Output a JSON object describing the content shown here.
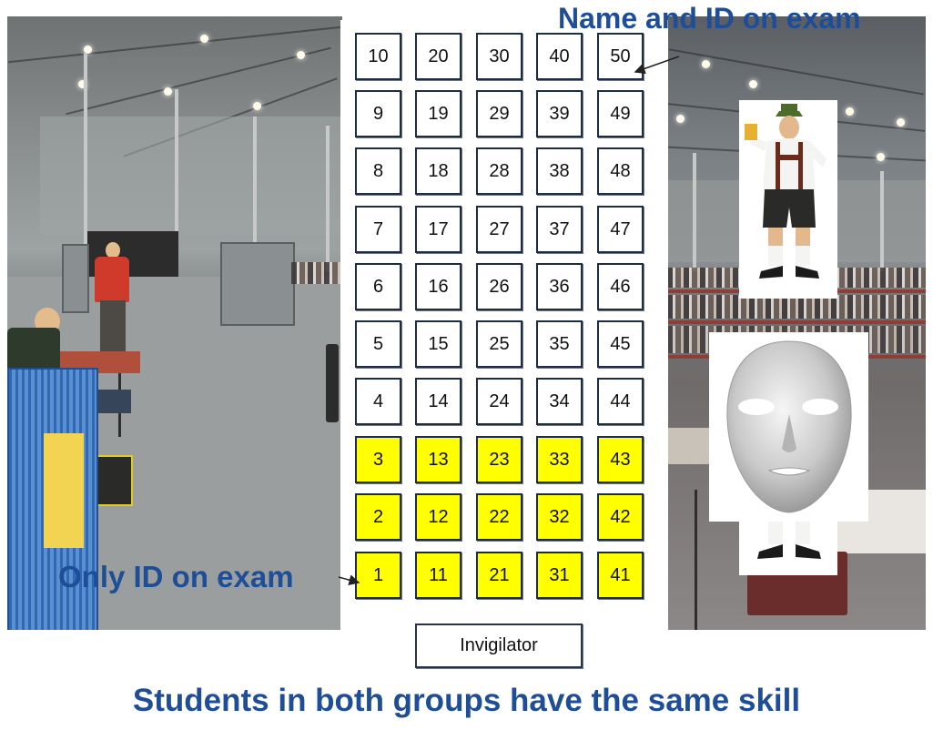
{
  "labels": {
    "name_and_id": "Name and ID on exam",
    "only_id": "Only ID on exam",
    "caption": "Students in both groups have the same skill"
  },
  "seating_chart": {
    "columns": [
      [
        "10",
        "9",
        "8",
        "7",
        "6",
        "5",
        "4",
        "3",
        "2",
        "1"
      ],
      [
        "20",
        "19",
        "18",
        "17",
        "16",
        "15",
        "14",
        "13",
        "12",
        "11"
      ],
      [
        "30",
        "29",
        "28",
        "27",
        "26",
        "25",
        "24",
        "23",
        "22",
        "21"
      ],
      [
        "40",
        "39",
        "38",
        "37",
        "36",
        "35",
        "34",
        "33",
        "32",
        "31"
      ],
      [
        "50",
        "49",
        "48",
        "47",
        "46",
        "45",
        "44",
        "43",
        "42",
        "41"
      ]
    ],
    "highlighted_rows_from_bottom": 3,
    "invigilator": "Invigilator"
  },
  "colors": {
    "label_blue": "#1f4e98",
    "highlight_yellow": "#ffff00",
    "seat_border": "#1e2c44"
  }
}
